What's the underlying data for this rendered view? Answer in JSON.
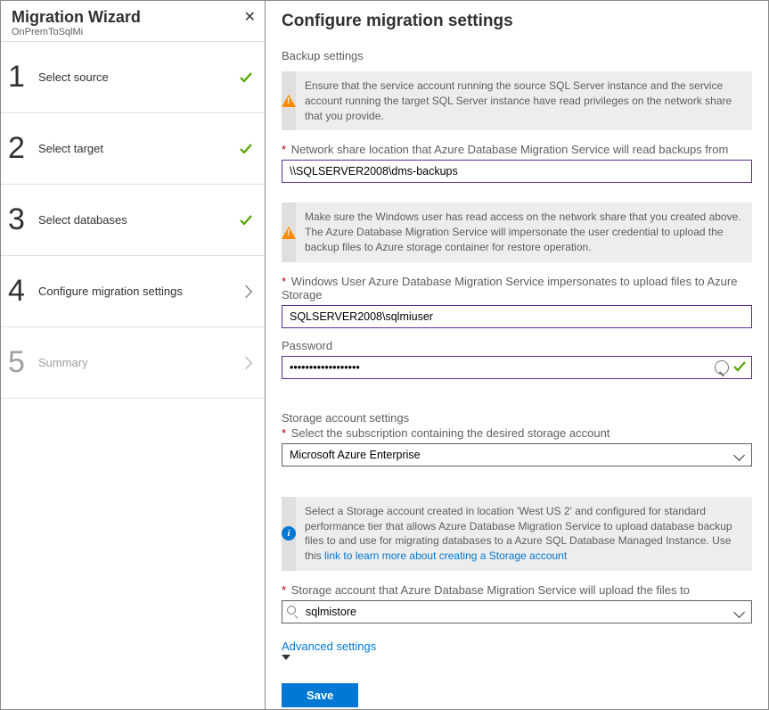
{
  "sidebar": {
    "title": "Migration Wizard",
    "subtitle": "OnPremToSqlMi",
    "steps": [
      {
        "num": "1",
        "label": "Select source",
        "status": "done"
      },
      {
        "num": "2",
        "label": "Select target",
        "status": "done"
      },
      {
        "num": "3",
        "label": "Select databases",
        "status": "done"
      },
      {
        "num": "4",
        "label": "Configure migration settings",
        "status": "current"
      },
      {
        "num": "5",
        "label": "Summary",
        "status": "pending"
      }
    ]
  },
  "main": {
    "title": "Configure migration settings",
    "backup_section": "Backup settings",
    "alert1": "Ensure that the service account running the source SQL Server instance and the service account running the target SQL Server instance have read privileges on the network share that you provide.",
    "share_label": "Network share location that Azure Database Migration Service will read backups from",
    "share_value": "\\\\SQLSERVER2008\\dms-backups",
    "alert2": "Make sure the Windows user has read access on the network share that you created above. The Azure Database Migration Service will impersonate the user credential to upload the backup files to Azure storage container for restore operation.",
    "user_label": "Windows User Azure Database Migration Service impersonates to upload files to Azure Storage",
    "user_value": "SQLSERVER2008\\sqlmiuser",
    "pw_label": "Password",
    "pw_value": "••••••••••••••••••",
    "storage_section": "Storage account settings",
    "sub_label": "Select the subscription containing the desired storage account",
    "sub_value": "Microsoft Azure Enterprise",
    "alert3_text": "Select a Storage account created in location 'West US 2' and configured for standard performance tier that allows Azure Database Migration Service to upload database backup files to and use for migrating databases to a Azure SQL Database Managed Instance. Use this ",
    "alert3_link": "link to learn more about creating a Storage account",
    "sa_label": "Storage account that Azure Database Migration Service will upload the files to",
    "sa_value": "sqlmistore",
    "adv": "Advanced settings",
    "save": "Save"
  }
}
